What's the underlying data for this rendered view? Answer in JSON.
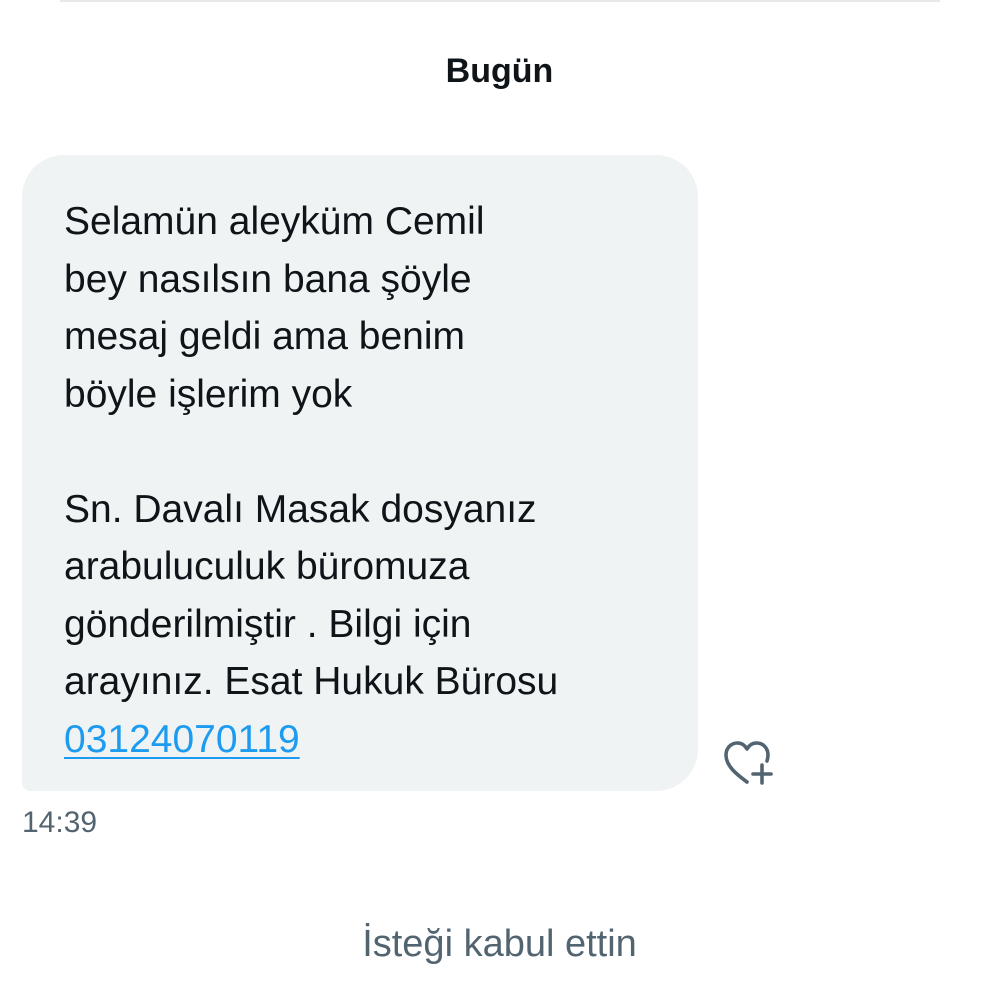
{
  "conversation": {
    "date_header": "Bugün",
    "message": {
      "lines_part1": [
        "Selamün aleyküm Cemil",
        "bey nasılsın bana şöyle",
        "mesaj geldi ama benim",
        "böyle işlerim yok"
      ],
      "lines_part2": [
        "Sn. Davalı Masak dosyanız",
        "arabuluculuk büromuza",
        "gönderilmiştir . Bilgi için",
        "arayınız. Esat Hukuk Bürosu"
      ],
      "phone_link": "03124070119",
      "timestamp": "14:39",
      "reaction_icon": "heart-plus-icon"
    },
    "status_note": "İsteği kabul ettin"
  },
  "colors": {
    "bubble_bg": "#eff3f4",
    "link": "#1d9bf0",
    "secondary_text": "#536471",
    "primary_text": "#0f1419"
  }
}
